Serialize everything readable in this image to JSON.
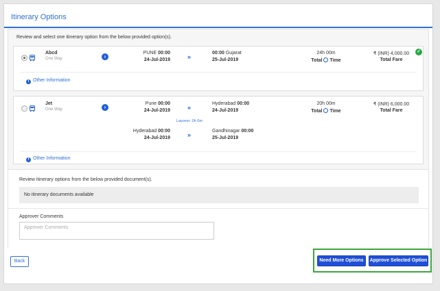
{
  "page": {
    "title": "Itinerary Options"
  },
  "instructions": "Review and select one itinerary option from the below provided option(s).",
  "options": [
    {
      "name": "Abcd",
      "type": "One Way",
      "selected": true,
      "segments": [
        {
          "from_city": "PUNE",
          "from_time": "00:00",
          "from_date": "24-Jul-2019",
          "to_time": "00:00",
          "to_city": "Gujarat",
          "to_date": "25-Jul-2019"
        }
      ],
      "duration": "24h 00m",
      "total_time_label": "Total",
      "time_label": "Time",
      "fare": "₹ (INR) 4,000.00",
      "fare_label": "Total Fare",
      "other_info": "Other Information"
    },
    {
      "name": "Jet",
      "type": "One Way",
      "selected": false,
      "segments": [
        {
          "from_city": "Pune",
          "from_time": "00:00",
          "from_date": "24-Jul-2019",
          "to_city": "Hyderabad",
          "to_time": "00:00",
          "to_date": "24-Jul-2019"
        },
        {
          "from_city": "Hyderabad",
          "from_time": "00:00",
          "from_date": "24-Jul-2019",
          "to_city": "Gandhinagar",
          "to_time": "00:00",
          "to_date": "25-Jul-2019"
        }
      ],
      "layover": "Layover: 0h 0m",
      "duration": "20h 00m",
      "total_time_label": "Total",
      "time_label": "Time",
      "fare": "₹ (INR) 6,000.00",
      "fare_label": "Total Fare",
      "other_info": "Other Information"
    }
  ],
  "documents": {
    "heading": "Review itinerary options from the below provided document(s).",
    "empty_text": "No itinerary documents available"
  },
  "comments": {
    "label": "Approver Comments",
    "placeholder": "Approver Comments"
  },
  "buttons": {
    "back": "Back",
    "need_more": "Need More Options",
    "approve": "Approve Selected Option"
  },
  "icons": {
    "go": "arrow-right-circle-icon",
    "chevron": "double-chevron-right-icon",
    "info": "info-icon",
    "clock": "clock-icon",
    "bus": "bus-icon",
    "check": "check-circle-icon"
  },
  "colors": {
    "accent": "#2e6fd6",
    "primary_button": "#1f4fd6",
    "highlight": "#3aa53a",
    "check": "#27a844"
  }
}
